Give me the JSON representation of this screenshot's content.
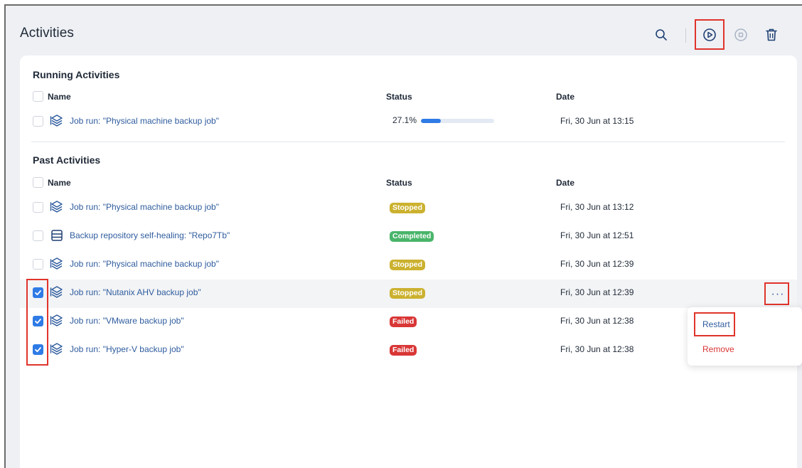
{
  "page": {
    "title": "Activities"
  },
  "toolbar": {
    "search_icon": "search-icon",
    "run_icon": "play-circle-icon",
    "stop_icon": "stop-circle-icon",
    "delete_icon": "trash-icon"
  },
  "running": {
    "title": "Running Activities",
    "columns": {
      "name": "Name",
      "status": "Status",
      "date": "Date"
    },
    "rows": [
      {
        "name": "Job run: \"Physical machine backup job\"",
        "progress_text": "27.1%",
        "progress": 0.271,
        "date": "Fri, 30 Jun at 13:15"
      }
    ]
  },
  "past": {
    "title": "Past Activities",
    "columns": {
      "name": "Name",
      "status": "Status",
      "date": "Date"
    },
    "rows": [
      {
        "name": "Job run: \"Physical machine backup job\"",
        "status": "Stopped",
        "date": "Fri, 30 Jun at 13:12",
        "checked": false,
        "icon": "job-icon"
      },
      {
        "name": "Backup repository self-healing: \"Repo7Tb\"",
        "status": "Completed",
        "date": "Fri, 30 Jun at 12:51",
        "checked": false,
        "icon": "repository-icon"
      },
      {
        "name": "Job run: \"Physical machine backup job\"",
        "status": "Stopped",
        "date": "Fri, 30 Jun at 12:39",
        "checked": false,
        "icon": "job-icon"
      },
      {
        "name": "Job run: \"Nutanix AHV backup job\"",
        "status": "Stopped",
        "date": "Fri, 30 Jun at 12:39",
        "checked": true,
        "icon": "job-icon"
      },
      {
        "name": "Job run: \"VMware backup job\"",
        "status": "Failed",
        "date": "Fri, 30 Jun at 12:38",
        "checked": true,
        "icon": "job-icon"
      },
      {
        "name": "Job run: \"Hyper-V backup job\"",
        "status": "Failed",
        "date": "Fri, 30 Jun at 12:38",
        "checked": true,
        "icon": "job-icon"
      }
    ]
  },
  "context_menu": {
    "more_label": "···",
    "items": [
      {
        "label": "Restart",
        "color": "#2f5c9e"
      },
      {
        "label": "Remove",
        "color": "#d93636"
      }
    ]
  },
  "colors": {
    "accent": "#2f7be6",
    "link": "#2f5c9e",
    "stopped": "#cbb12f",
    "completed": "#49b56a",
    "failed": "#d93636",
    "highlight": "#e0342b"
  }
}
